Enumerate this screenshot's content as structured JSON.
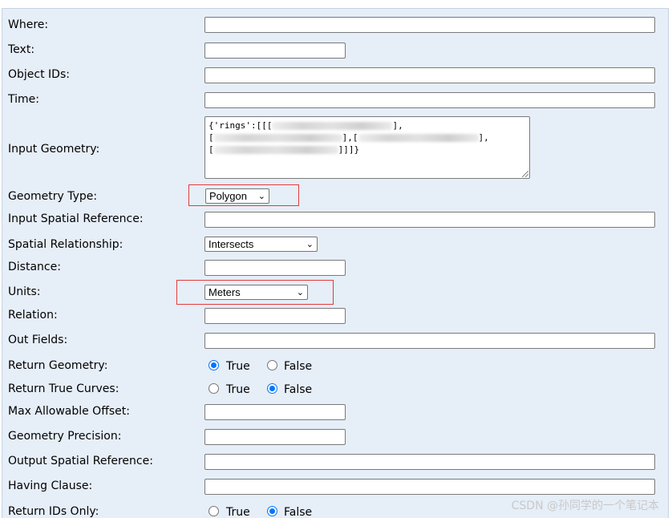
{
  "form": {
    "where": {
      "label": "Where:",
      "value": ""
    },
    "text": {
      "label": "Text:",
      "value": ""
    },
    "object_ids": {
      "label": "Object IDs:",
      "value": ""
    },
    "time": {
      "label": "Time:",
      "value": ""
    },
    "input_geometry": {
      "label": "Input Geometry:",
      "line1_prefix": "{'rings':[[[",
      "line1_suffix": "],",
      "line2_prefix": "[",
      "line2_mid": "],[",
      "line2_suffix": "],",
      "line3_prefix": "[",
      "line3_suffix": "]]]}"
    },
    "geometry_type": {
      "label": "Geometry Type:",
      "value": "Polygon"
    },
    "input_spatial_reference": {
      "label": "Input Spatial Reference:",
      "value": ""
    },
    "spatial_relationship": {
      "label": "Spatial Relationship:",
      "value": "Intersects"
    },
    "distance": {
      "label": "Distance:",
      "value": ""
    },
    "units": {
      "label": "Units:",
      "value": "Meters"
    },
    "relation": {
      "label": "Relation:",
      "value": ""
    },
    "out_fields": {
      "label": "Out Fields:",
      "value": ""
    },
    "return_geometry": {
      "label": "Return Geometry:",
      "true_label": "True",
      "false_label": "False",
      "selected": "True"
    },
    "return_true_curves": {
      "label": "Return True Curves:",
      "true_label": "True",
      "false_label": "False",
      "selected": "False"
    },
    "max_allowable_offset": {
      "label": "Max Allowable Offset:",
      "value": ""
    },
    "geometry_precision": {
      "label": "Geometry Precision:",
      "value": ""
    },
    "output_spatial_reference": {
      "label": "Output Spatial Reference:",
      "value": ""
    },
    "having_clause": {
      "label": "Having Clause:",
      "value": ""
    },
    "return_ids_only": {
      "label": "Return IDs Only:",
      "true_label": "True",
      "false_label": "False",
      "selected": "False"
    }
  },
  "icons": {
    "dropdown": "chevron-down-icon",
    "resize": "resize-grip-icon"
  },
  "colors": {
    "panel_bg": "#e6eef8",
    "highlight_box": "#e53a3a",
    "radio_accent": "#0075ff"
  },
  "watermark": "CSDN @孙同学的一个笔记本"
}
